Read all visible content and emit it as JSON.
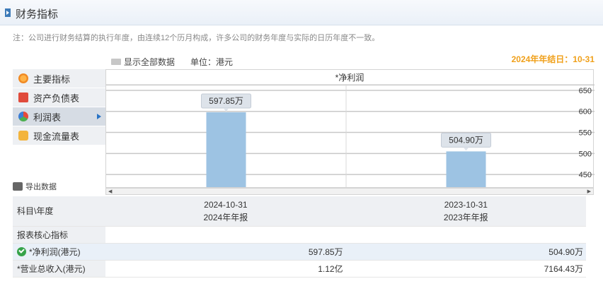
{
  "header": {
    "title": "财务指标"
  },
  "note": "注：公司进行财务结算的执行年度，由连续12个历月构成，许多公司的财务年度与实际的日历年度不一致。",
  "toolbar": {
    "show_all": "显示全部数据",
    "unit": "单位：港元"
  },
  "date_end": "2024年年结日：10-31",
  "sidebar": {
    "items": [
      {
        "label": "主要指标",
        "icon": "sun-icon"
      },
      {
        "label": "资产负债表",
        "icon": "document-icon"
      },
      {
        "label": "利润表",
        "icon": "pie-chart-icon",
        "active": true
      },
      {
        "label": "现金流量表",
        "icon": "coins-icon"
      }
    ]
  },
  "export_label": "导出数据",
  "chart_data": {
    "type": "bar",
    "title": "*净利润",
    "categories": [
      "2024-10-31",
      "2023-10-31"
    ],
    "values": [
      597.85,
      504.9
    ],
    "data_labels": [
      "597.85万",
      "504.90万"
    ],
    "y_ticks": [
      450,
      500,
      550,
      600,
      650
    ],
    "ylim": [
      420,
      665
    ],
    "y_axis_side": "right",
    "grid": true,
    "colors": {
      "bar": "#9dc3e3",
      "label_bg": "#dde3ea"
    }
  },
  "table": {
    "header": {
      "label": "科目\\年度",
      "col1_date": "2024-10-31",
      "col1_type": "2024年年报",
      "col2_date": "2023-10-31",
      "col2_type": "2023年年报"
    },
    "section": "报表核心指标",
    "rows": [
      {
        "label": "*净利润(港元)",
        "v1": "597.85万",
        "v2": "504.90万",
        "checked": true
      },
      {
        "label": "*营业总收入(港元)",
        "v1": "1.12亿",
        "v2": "7164.43万"
      }
    ]
  }
}
